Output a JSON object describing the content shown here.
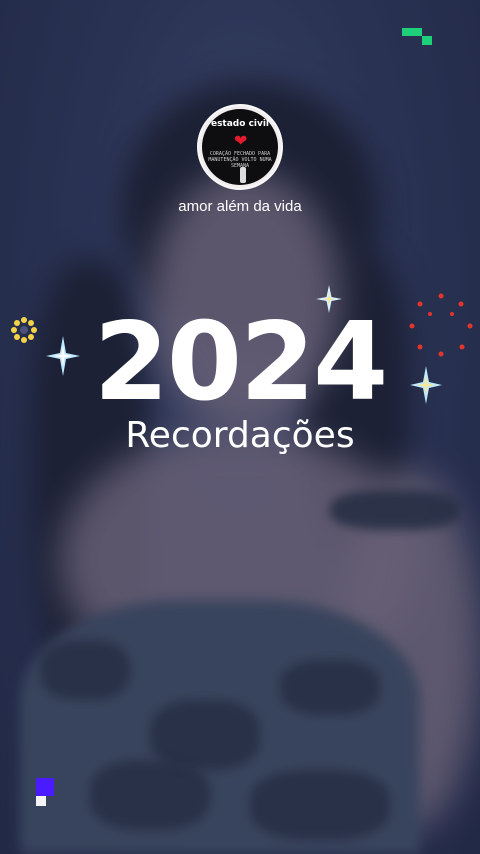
{
  "profile": {
    "avatar_caption": "estado civil",
    "avatar_text": "CORAÇÃO FECHADO PARA MANUTENÇÃO VOLTO NUMA SEMANA",
    "username": "amor além da vida"
  },
  "banner": {
    "year": "2024",
    "subtitle": "Recordações"
  },
  "colors": {
    "accent_green": "#1fd07a",
    "accent_purple": "#4b1bff",
    "sparkle_yellow": "#f4d34a",
    "dots_red": "#e0362c"
  },
  "icons": [
    "sparkle-icon",
    "yellow-flower-icon",
    "red-dot-ring-icon",
    "green-pixel-icon",
    "purple-pixel-icon"
  ]
}
